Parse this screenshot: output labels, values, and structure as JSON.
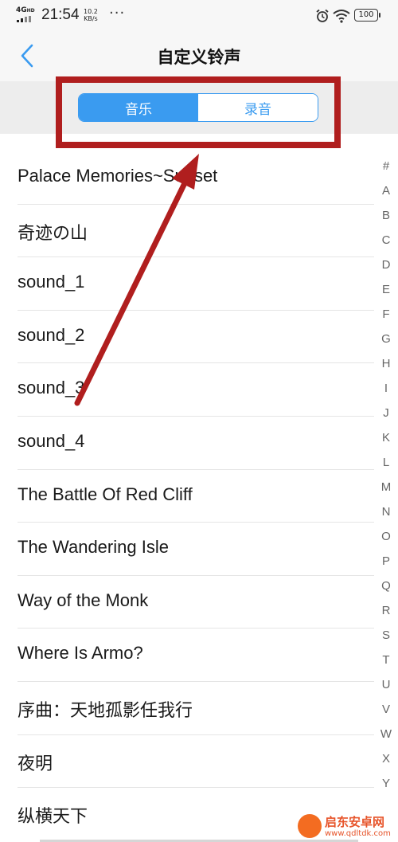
{
  "status_bar": {
    "network": "4G",
    "network_sub": "HD",
    "time": "21:54",
    "speed_value": "10.2",
    "speed_unit": "KB/s",
    "more": "···",
    "battery": "100"
  },
  "header": {
    "title": "自定义铃声"
  },
  "tabs": [
    {
      "label": "音乐",
      "active": true
    },
    {
      "label": "录音",
      "active": false
    }
  ],
  "list": {
    "items": [
      "Palace Memories~Sunset",
      "奇迹の山",
      "sound_1",
      "sound_2",
      "sound_3",
      "sound_4",
      "The Battle Of Red Cliff",
      "The Wandering Isle",
      "Way of the Monk",
      "Where Is Armo?",
      "序曲：天地孤影任我行",
      "夜明",
      "纵横天下"
    ]
  },
  "alphabet_index": [
    "#",
    "A",
    "B",
    "C",
    "D",
    "E",
    "F",
    "G",
    "H",
    "I",
    "J",
    "K",
    "L",
    "M",
    "N",
    "O",
    "P",
    "Q",
    "R",
    "S",
    "T",
    "U",
    "V",
    "W",
    "X",
    "Y"
  ],
  "watermark": {
    "line1": "启东安卓网",
    "line2": "www.qdltdk.com"
  },
  "colors": {
    "accent": "#3a9bf0",
    "annotation": "#b01e1e",
    "watermark": "#e7542a"
  }
}
